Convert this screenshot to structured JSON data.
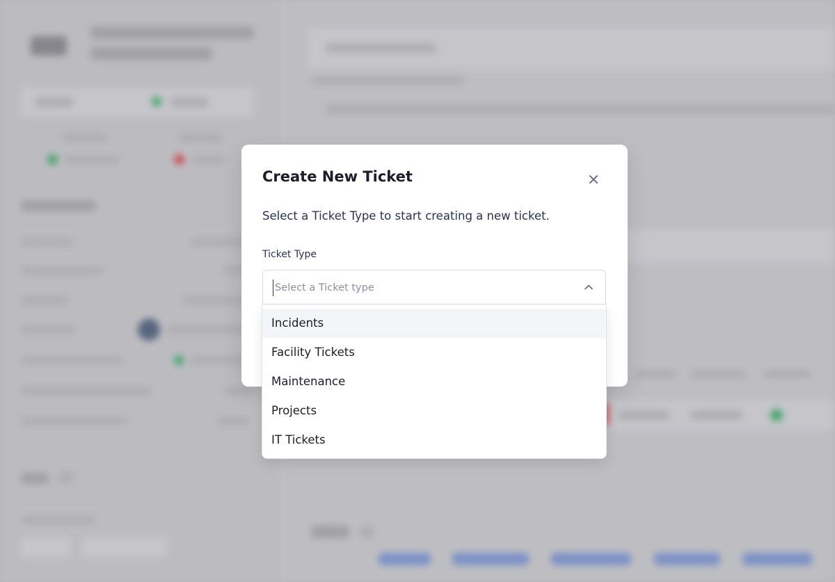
{
  "modal": {
    "title": "Create New Ticket",
    "description": "Select a Ticket Type to start creating a new ticket.",
    "close_icon": "close-icon"
  },
  "ticket_type": {
    "label": "Ticket Type",
    "placeholder": "Select a Ticket type",
    "value": "",
    "dropdown_icon": "chevron-up-icon",
    "options": [
      {
        "label": "Incidents",
        "highlighted": true
      },
      {
        "label": "Facility Tickets",
        "highlighted": false
      },
      {
        "label": "Maintenance",
        "highlighted": false
      },
      {
        "label": "Projects",
        "highlighted": false
      },
      {
        "label": "IT Tickets",
        "highlighted": false
      }
    ]
  },
  "colors": {
    "text_primary": "#1d1d2b",
    "text_secondary": "#2b3250",
    "placeholder": "#8a8fa3",
    "highlight": "#f4f5f9",
    "icon": "#6b7089"
  }
}
